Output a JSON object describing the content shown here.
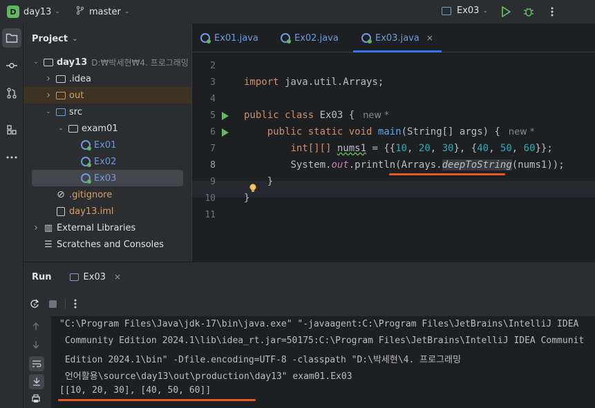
{
  "titlebar": {
    "project_badge": "D",
    "project_name": "day13",
    "branch": "master",
    "run_config": "Ex03"
  },
  "project_panel": {
    "title": "Project",
    "tree": [
      {
        "label": "day13",
        "path": "D:₩박세현₩4. 프로그래밍",
        "indent": 0,
        "arrow": "down",
        "icon": "module-folder-icon",
        "bold": true
      },
      {
        "label": ".idea",
        "indent": 1,
        "arrow": "right",
        "icon": "folder-icon"
      },
      {
        "label": "out",
        "indent": 1,
        "arrow": "right",
        "icon": "folder-orange-icon",
        "color": "orange",
        "highlight": true
      },
      {
        "label": "src",
        "indent": 1,
        "arrow": "down",
        "icon": "folder-blue-icon"
      },
      {
        "label": "exam01",
        "indent": 2,
        "arrow": "down",
        "icon": "package-icon"
      },
      {
        "label": "Ex01",
        "indent": 3,
        "icon": "java-class-icon",
        "color": "blue"
      },
      {
        "label": "Ex02",
        "indent": 3,
        "icon": "java-class-icon",
        "color": "blue"
      },
      {
        "label": "Ex03",
        "indent": 3,
        "icon": "java-class-icon",
        "color": "blue",
        "selected": true
      },
      {
        "label": ".gitignore",
        "indent": 1,
        "icon": "ignore-file-icon",
        "color": "orange"
      },
      {
        "label": "day13.iml",
        "indent": 1,
        "icon": "iml-file-icon",
        "color": "orange"
      },
      {
        "label": "External Libraries",
        "indent": 0,
        "arrow": "right",
        "icon": "library-icon"
      },
      {
        "label": "Scratches and Consoles",
        "indent": 0,
        "icon": "scratches-icon"
      }
    ]
  },
  "editor": {
    "tabs": [
      {
        "label": "Ex01.java",
        "active": false
      },
      {
        "label": "Ex02.java",
        "active": false
      },
      {
        "label": "Ex03.java",
        "active": true
      }
    ],
    "close_glyph": "×",
    "line_numbers": [
      "2",
      "3",
      "4",
      "5",
      "6",
      "7",
      "8",
      "9",
      "10",
      "11"
    ],
    "line1": {
      "kw": "import",
      "rest": " java.util.Arrays;"
    },
    "line2": {
      "kw1": "public",
      "kw2": "class",
      "name": " Ex03 {",
      "hint": "new *"
    },
    "line3": {
      "kw1": "public",
      "kw2": "static",
      "kw3": "void",
      "method": "main",
      "rest": "(String[] args) {",
      "hint": "new *"
    },
    "line4": {
      "type": "int[][] ",
      "var": "nums1",
      "eq": " = {{",
      "n1": "10",
      "n2": "20",
      "n3": "30",
      "mid": "}, {",
      "n4": "40",
      "n5": "50",
      "n6": "60",
      "end": "}};",
      "sep": ", "
    },
    "line5": {
      "cls": "System.",
      "field": "out",
      "call": ".println(Arrays.",
      "method": "deepToString",
      "end": "(nums1));"
    },
    "line6": "}",
    "line7": "}"
  },
  "run_panel": {
    "title": "Run",
    "tab_label": "Ex03",
    "console_lines": [
      "\"C:\\Program Files\\Java\\jdk-17\\bin\\java.exe\" \"-javaagent:C:\\Program Files\\JetBrains\\IntelliJ IDEA",
      " Community Edition 2024.1\\lib\\idea_rt.jar=50175:C:\\Program Files\\JetBrains\\IntelliJ IDEA Communit",
      " Edition 2024.1\\bin\" -Dfile.encoding=UTF-8 -classpath \"D:\\박세현\\4. 프로그래밍",
      " 언어활용\\source\\day13\\out\\production\\day13\" exam01.Ex03",
      "[[10, 20, 30], [40, 50, 60]]"
    ]
  },
  "colors": {
    "accent": "#3574f0",
    "run_green": "#5fb760",
    "annotation_red": "#e55b1f"
  }
}
